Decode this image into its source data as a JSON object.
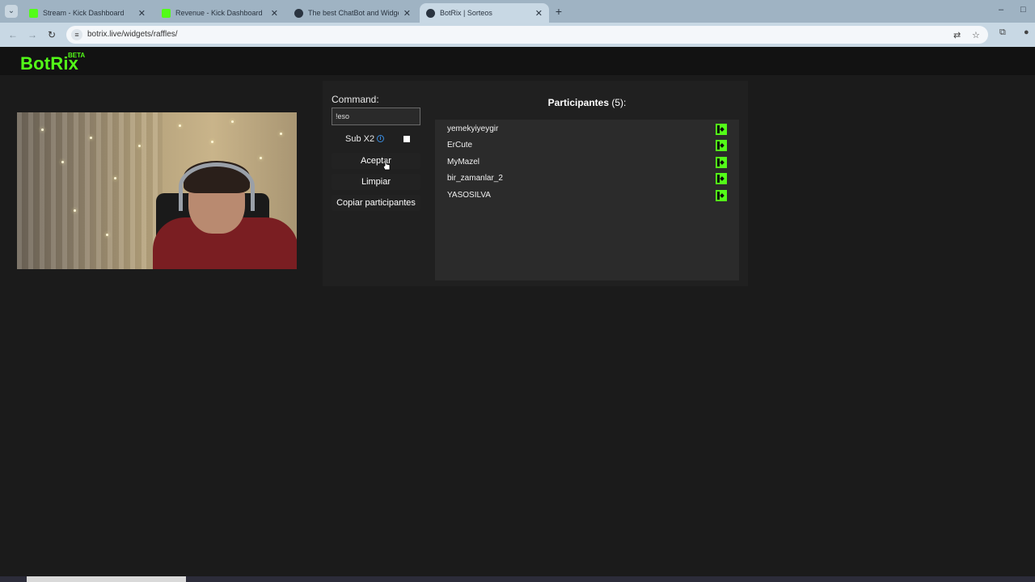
{
  "browser": {
    "tabs": [
      {
        "title": "Stream - Kick Dashboard",
        "favicon": "kick-icon",
        "active": false
      },
      {
        "title": "Revenue - Kick Dashboard",
        "favicon": "kick-icon",
        "active": false
      },
      {
        "title": "The best ChatBot and Widgets",
        "favicon": "botrix-icon",
        "active": false
      },
      {
        "title": "BotRix | Sorteos",
        "favicon": "botrix-icon",
        "active": true
      }
    ],
    "tab_close": "✕",
    "new_tab": "+",
    "url": "botrix.live/widgets/raffles/"
  },
  "site": {
    "logo": "BotRix",
    "badge": "BETA",
    "brand_color": "#53fc18"
  },
  "raffle": {
    "command_label": "Command:",
    "command_value": "!eso",
    "sub_label": "Sub X2",
    "sub_checked": false,
    "accept_label": "Aceptar",
    "clear_label": "Limpiar",
    "copy_label": "Copiar participantes"
  },
  "participants": {
    "title": "Participantes",
    "count": "(5):",
    "items": [
      {
        "name": "yemekyiyeygir",
        "platform": "kick-icon"
      },
      {
        "name": "ErCute",
        "platform": "kick-icon"
      },
      {
        "name": "MyMazel",
        "platform": "kick-icon"
      },
      {
        "name": "bir_zamanlar_2",
        "platform": "kick-icon"
      },
      {
        "name": "YASOSILVA",
        "platform": "kick-icon"
      }
    ]
  }
}
